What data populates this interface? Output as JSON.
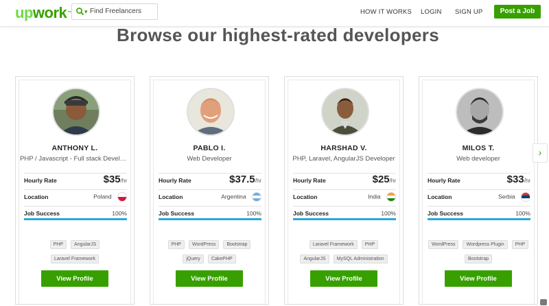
{
  "header": {
    "logo_up": "up",
    "logo_work": "work",
    "search": {
      "placeholder": "Find Freelancers",
      "icon": "search-icon"
    },
    "nav": [
      "HOW IT WORKS",
      "LOGIN",
      "SIGN UP"
    ],
    "post_job": "Post a Job"
  },
  "page": {
    "title": "Browse our highest-rated developers"
  },
  "labels": {
    "hourly_rate": "Hourly Rate",
    "location": "Location",
    "job_success": "Job Success",
    "view_profile": "View Profile",
    "per_hr": "/hr"
  },
  "freelancers": [
    {
      "name": "ANTHONY L.",
      "title": "PHP / Javascript - Full stack Developer",
      "rate": "$35",
      "location": "Poland",
      "flag": "poland-flag",
      "job_success": "100%",
      "job_success_fraction": 1.0,
      "skills": [
        "PHP",
        "AngularJS",
        "Laravel Framework"
      ]
    },
    {
      "name": "PABLO I.",
      "title": "Web Developer",
      "rate": "$37.5",
      "location": "Argentina",
      "flag": "argentina-flag",
      "job_success": "100%",
      "job_success_fraction": 1.0,
      "skills": [
        "PHP",
        "WordPress",
        "Bootstrap",
        "jQuery",
        "CakePHP"
      ]
    },
    {
      "name": "HARSHAD V.",
      "title": "PHP, Laravel, AngularJS Developer",
      "rate": "$25",
      "location": "India",
      "flag": "india-flag",
      "job_success": "100%",
      "job_success_fraction": 1.0,
      "skills": [
        "Laravel Framework",
        "PHP",
        "AngularJS",
        "MySQL Administration"
      ]
    },
    {
      "name": "MILOS T.",
      "title": "Web developer",
      "rate": "$33",
      "location": "Serbia",
      "flag": "serbia-flag",
      "job_success": "100%",
      "job_success_fraction": 1.0,
      "skills": [
        "WordPress",
        "Wordpress Plugin",
        "PHP",
        "Bootstrap"
      ]
    }
  ],
  "colors": {
    "brand_green": "#37a000",
    "progress_blue": "#28a9d8"
  }
}
